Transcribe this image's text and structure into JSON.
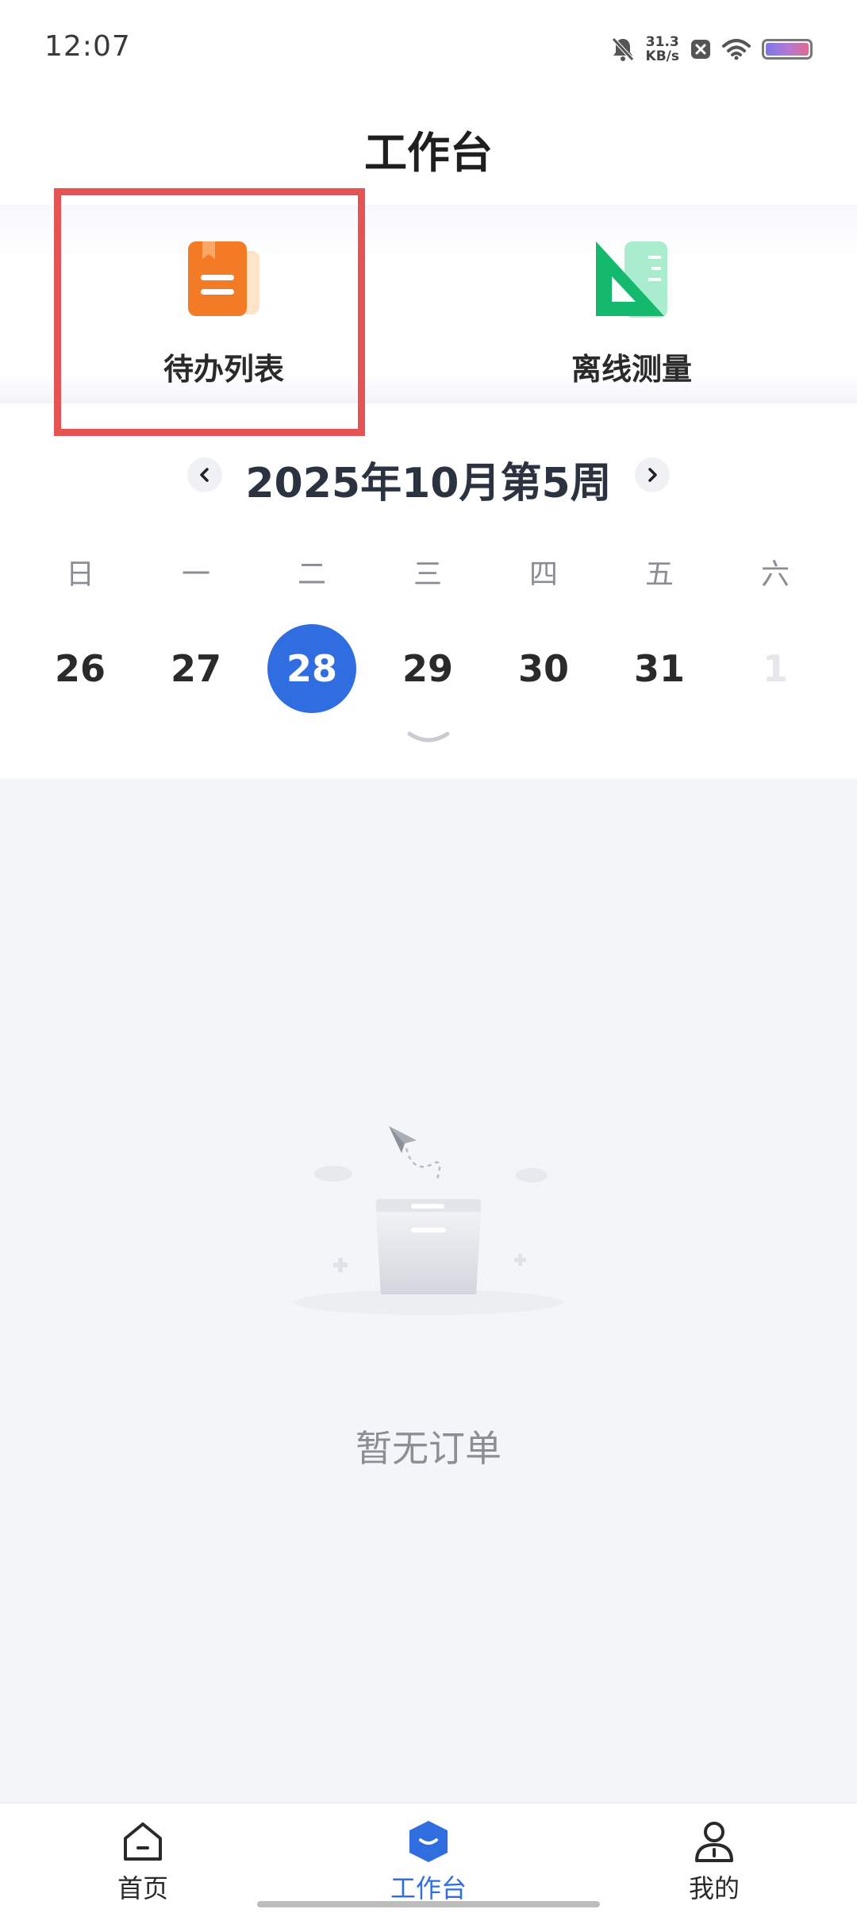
{
  "status_bar": {
    "time": "12:07",
    "net_speed_value": "31.3",
    "net_speed_unit": "KB/s",
    "icons": [
      "bell-muted-icon",
      "close-box-icon",
      "wifi-icon",
      "battery-icon"
    ]
  },
  "header": {
    "title": "工作台"
  },
  "quick_actions": [
    {
      "label": "待办列表",
      "icon": "document-list-icon",
      "color": "#f47b25",
      "highlighted": true
    },
    {
      "label": "离线测量",
      "icon": "set-square-icon",
      "color": "#14b96e",
      "highlighted": false
    }
  ],
  "calendar": {
    "week_title": "2025年10月第5周",
    "prev_icon": "chevron-left-icon",
    "next_icon": "chevron-right-icon",
    "weekdays": [
      "日",
      "一",
      "二",
      "三",
      "四",
      "五",
      "六"
    ],
    "dates": [
      "26",
      "27",
      "28",
      "29",
      "30",
      "31",
      "1"
    ],
    "selected_index": 2,
    "accent_color": "#2f6de0",
    "expand_icon": "chevron-down-icon"
  },
  "empty_state": {
    "message": "暂无订单",
    "illustration": "empty-box-icon"
  },
  "tab_bar": {
    "items": [
      {
        "label": "首页",
        "icon": "home-icon",
        "active": false
      },
      {
        "label": "工作台",
        "icon": "workbench-icon",
        "active": true
      },
      {
        "label": "我的",
        "icon": "user-icon",
        "active": false
      }
    ]
  }
}
